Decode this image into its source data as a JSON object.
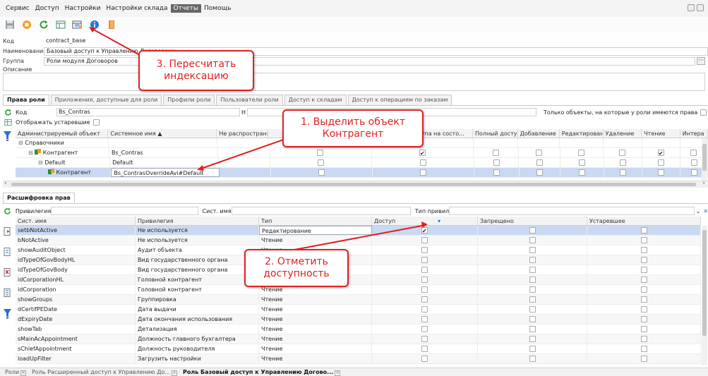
{
  "menu": [
    "Сервис",
    "Доступ",
    "Настройки",
    "Настройки склада",
    "Отчеты",
    "Помощь"
  ],
  "menu_active_index": 4,
  "form": {
    "kod_label": "Код",
    "kod_value": "contract_base",
    "name_label": "Наименование",
    "name_value": "Базовый доступ к Управлению Договорами",
    "group_label": "Группа",
    "group_value": "Роли модуля Договоров",
    "group_btn": "···",
    "desc_label": "Описание"
  },
  "tabs": [
    "Права роли",
    "Приложения, доступные для роли",
    "Профили роли",
    "Пользователи роли",
    "Доступ к складам",
    "Доступ к операциям по заказам"
  ],
  "roles_filter": {
    "kod_label": "Код",
    "kod_value": "Bs_Contras",
    "h_label": "Н",
    "only_label": "Только объекты, на которые у роли имеются права",
    "show_obsolete_label": "Отображать устаревшие"
  },
  "objects_grid": {
    "headers": [
      "Администрируемый объект",
      "Системное имя ▲",
      "Не распространять",
      "",
      "Изменение доступа на состо...",
      "Полный доступ",
      "Добавление",
      "Редактирование",
      "Удаление",
      "Чтение",
      "Интера"
    ],
    "rows": [
      {
        "name": "Справочники",
        "sys": "",
        "level": 0,
        "tree": "⊟",
        "icon": false,
        "checks": [
          false,
          false,
          false,
          false,
          false,
          false,
          false,
          false
        ],
        "has_checks": false
      },
      {
        "name": "Контрагент",
        "sys": "Bs_Contras",
        "level": 1,
        "tree": "⊟",
        "icon": true,
        "checks": [
          false,
          true,
          false,
          false,
          false,
          false,
          true,
          false
        ],
        "has_checks": true
      },
      {
        "name": "Default",
        "sys": "Default",
        "level": 2,
        "tree": "⊟",
        "icon": false,
        "checks": [
          false,
          false,
          false,
          false,
          false,
          false,
          false,
          false
        ],
        "has_checks": true
      },
      {
        "name": "Контрагент",
        "sys": "Bs_ContrasOverrideAvi#Default",
        "level": 3,
        "tree": "",
        "icon": true,
        "checks": [
          false,
          false,
          false,
          false,
          false,
          false,
          false,
          false
        ],
        "has_checks": true
      }
    ]
  },
  "privileges": {
    "section_tab": "Расшифровка прав",
    "filter_priv_label": "Привилегия",
    "filter_sys_label": "Сист. имя",
    "filter_type_label": "Тип привилегии",
    "headers": [
      "Сист. имя",
      "Привилегия",
      "Тип",
      "Доступ",
      "Запрещено",
      "Устаревшее"
    ],
    "rows": [
      {
        "sys": "setbNotActive",
        "priv": "Не используется",
        "type": "Редактирование",
        "access": true
      },
      {
        "sys": "bNotActive",
        "priv": "Не используется",
        "type": "Чтение",
        "access": false
      },
      {
        "sys": "showAuditObject",
        "priv": "Аудит объекта",
        "type": "Чтение",
        "access": false
      },
      {
        "sys": "idTypeOfGovBodyHL",
        "priv": "Вид государственного органа",
        "type": "Чтение",
        "access": false
      },
      {
        "sys": "idTypeOfGovBody",
        "priv": "Вид государственного органа",
        "type": "Чтение",
        "access": false
      },
      {
        "sys": "idCorporationHL",
        "priv": "Головной контрагент",
        "type": "Чтение",
        "access": false
      },
      {
        "sys": "idCorporation",
        "priv": "Головной контрагент",
        "type": "Чтение",
        "access": false
      },
      {
        "sys": "showGroups",
        "priv": "Группировка",
        "type": "Чтение",
        "access": false
      },
      {
        "sys": "dCertifPEDate",
        "priv": "Дата выдачи",
        "type": "Чтение",
        "access": false
      },
      {
        "sys": "dExpiryDate",
        "priv": "Дата окончания использования",
        "type": "Чтение",
        "access": false
      },
      {
        "sys": "showTab",
        "priv": "Детализация",
        "type": "Чтение",
        "access": false
      },
      {
        "sys": "sMainAcAppointment",
        "priv": "Должность главного бухгалтера",
        "type": "Чтение",
        "access": false
      },
      {
        "sys": "sChiefAppointment",
        "priv": "Должность руководителя",
        "type": "Чтение",
        "access": false
      },
      {
        "sys": "loadUpFilter",
        "priv": "Загрузить настройки",
        "type": "Чтение",
        "access": false
      }
    ]
  },
  "callouts": {
    "c1": "1. Выделить объект Контрагент",
    "c2": "2. Отметить доступность",
    "c3": "3. Пересчитать индексацию"
  },
  "status_tabs": [
    "Роли",
    "Роль Расширенный доступ к Управлению До...",
    "Роль Базовый доступ к Управлению Догово..."
  ],
  "status_active_index": 2,
  "colors": {
    "accent_red": "#e02020",
    "selection": "#c9d9f2",
    "menu_active": "#666666"
  }
}
